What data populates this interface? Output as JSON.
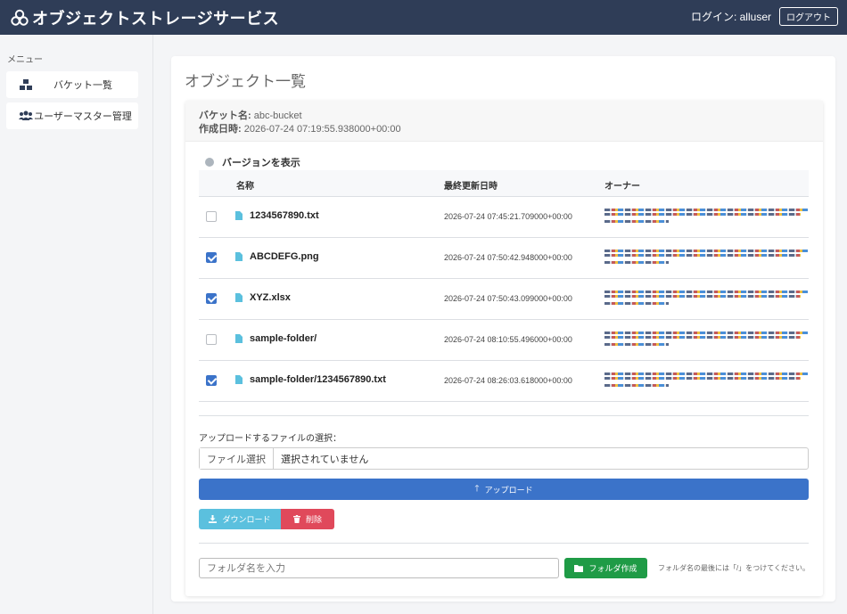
{
  "header": {
    "title": "オブジェクトストレージサービス",
    "login_text": "ログイン: alluser",
    "logout_label": "ログアウト"
  },
  "sidebar": {
    "heading": "メニュー",
    "items": [
      {
        "label": "バケット一覧",
        "icon": "cubes-icon"
      },
      {
        "label": "ユーザーマスター管理",
        "icon": "users-icon"
      }
    ]
  },
  "main": {
    "page_title": "オブジェクト一覧",
    "bucket_label": "バケット名:",
    "bucket_name": "abc-bucket",
    "created_label": "作成日時:",
    "created_value": "2026-07-24 07:19:55.938000+00:00",
    "version_toggle_label": "バージョンを表示",
    "columns": {
      "name": "名称",
      "updated": "最終更新日時",
      "owner": "オーナー"
    },
    "rows": [
      {
        "name": "1234567890.txt",
        "updated": "2026-07-24 07:45:21.709000+00:00",
        "checked": false
      },
      {
        "name": "ABCDEFG.png",
        "updated": "2026-07-24 07:50:42.948000+00:00",
        "checked": true
      },
      {
        "name": "XYZ.xlsx",
        "updated": "2026-07-24 07:50:43.099000+00:00",
        "checked": true
      },
      {
        "name": "sample-folder/",
        "updated": "2026-07-24 08:10:55.496000+00:00",
        "checked": false
      },
      {
        "name": "sample-folder/1234567890.txt",
        "updated": "2026-07-24 08:26:03.618000+00:00",
        "checked": true
      }
    ],
    "upload": {
      "label": "アップロードするファイルの選択：",
      "file_button": "ファイル選択",
      "file_status": "選択されていません",
      "upload_button": "アップロード"
    },
    "actions": {
      "download": "ダウンロード",
      "delete": "削除"
    },
    "folder": {
      "placeholder": "フォルダ名を入力",
      "create_button": "フォルダ作成",
      "hint": "フォルダ名の最後には「/」をつけてください。"
    }
  },
  "colors": {
    "header_bg": "#2f3d57",
    "primary": "#3b73c9",
    "info": "#5bc0de",
    "danger": "#e0495b",
    "success": "#1f9b46"
  }
}
